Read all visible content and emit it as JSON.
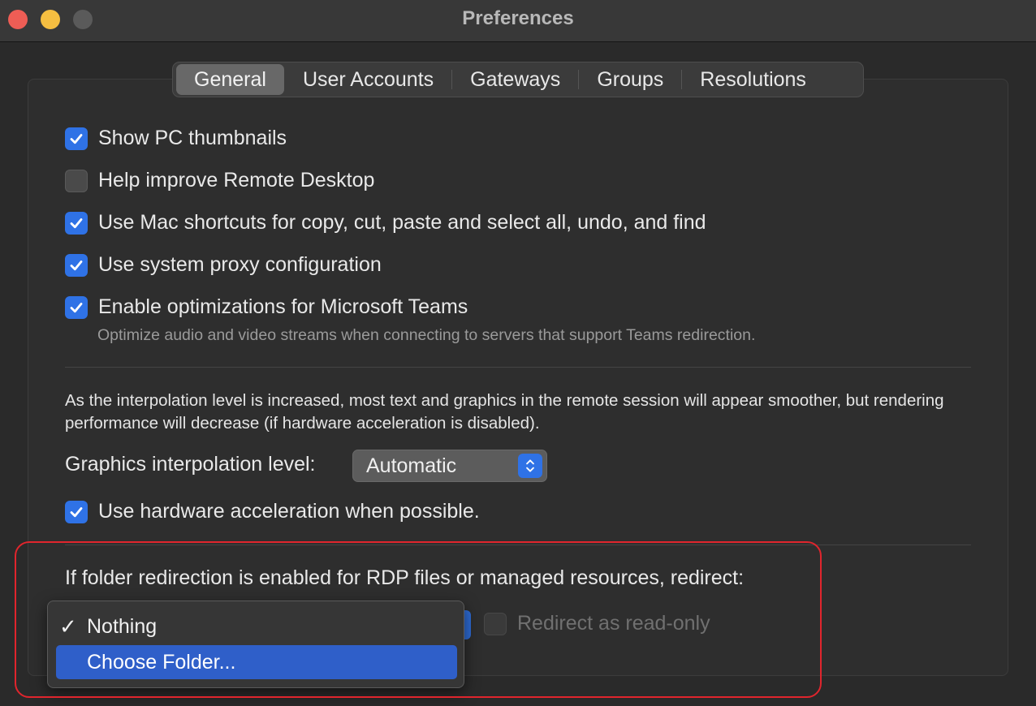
{
  "window": {
    "title": "Preferences"
  },
  "tabs": [
    {
      "label": "General",
      "active": true
    },
    {
      "label": "User Accounts",
      "active": false
    },
    {
      "label": "Gateways",
      "active": false
    },
    {
      "label": "Groups",
      "active": false
    },
    {
      "label": "Resolutions",
      "active": false
    }
  ],
  "options": [
    {
      "label": "Show PC thumbnails",
      "checked": true
    },
    {
      "label": "Help improve Remote Desktop",
      "checked": false
    },
    {
      "label": "Use Mac shortcuts for copy, cut, paste and select all, undo, and find",
      "checked": true
    },
    {
      "label": "Use system proxy configuration",
      "checked": true
    },
    {
      "label": "Enable optimizations for Microsoft Teams",
      "checked": true
    }
  ],
  "teams_description": "Optimize audio and video streams when connecting to servers that support Teams redirection.",
  "interpolation": {
    "paragraph": "As the interpolation level is increased, most text and graphics in the remote session will appear smoother, but rendering performance will decrease (if hardware acceleration is disabled).",
    "label": "Graphics interpolation level:",
    "value": "Automatic"
  },
  "hardware_accel": {
    "label": "Use hardware acceleration when possible.",
    "checked": true
  },
  "folder_redirect": {
    "label": "If folder redirection is enabled for RDP files or managed resources, redirect:",
    "read_only_label": "Redirect as read-only",
    "read_only_checked": false,
    "menu": [
      {
        "label": "Nothing",
        "checkmark": "✓",
        "checked": true,
        "highlighted": false
      },
      {
        "label": "Choose Folder...",
        "checked": false,
        "highlighted": true
      }
    ]
  },
  "colors": {
    "accent": "#2f72e6",
    "highlight_border": "#e0252d",
    "menu_selection": "#2f5fc9"
  }
}
